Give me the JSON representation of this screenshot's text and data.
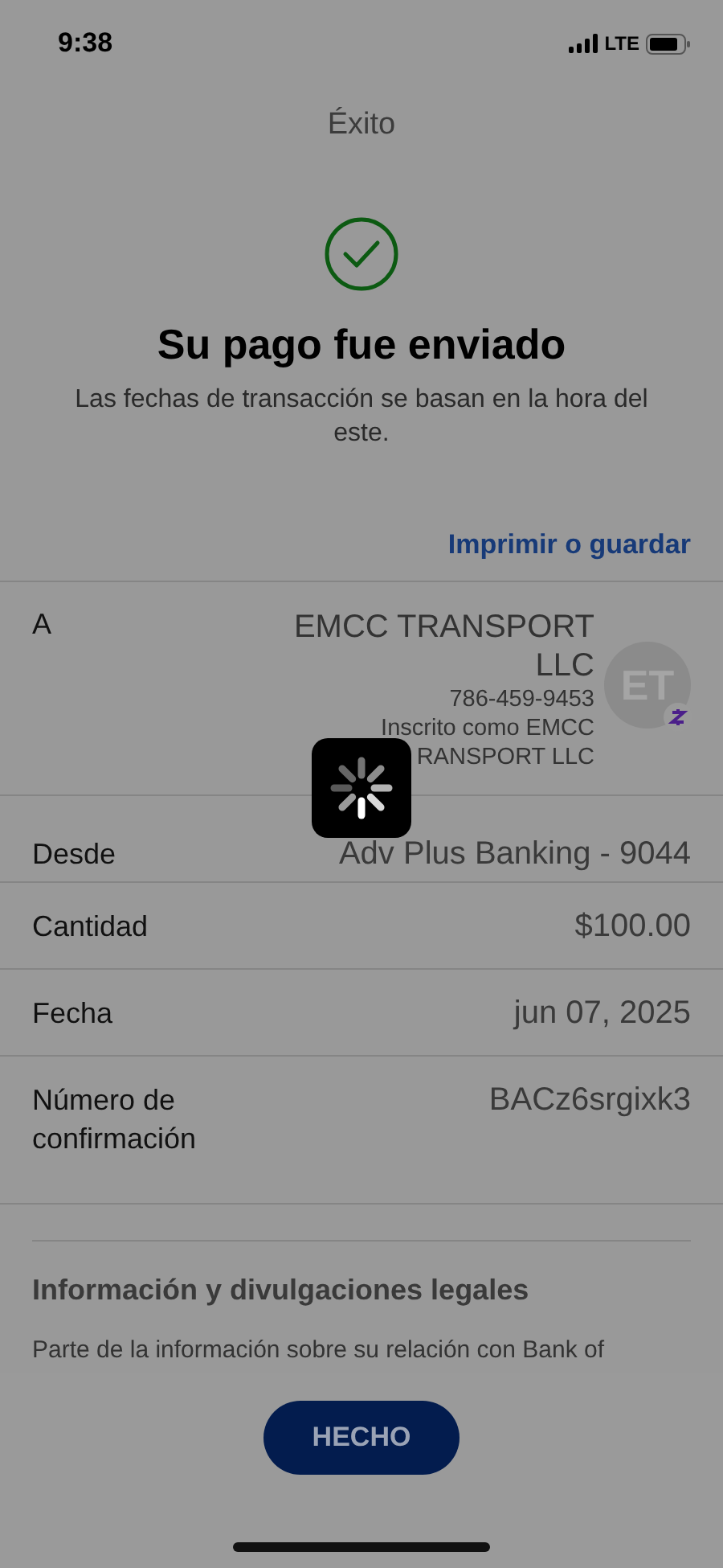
{
  "status_bar": {
    "time": "9:38",
    "network": "LTE"
  },
  "header": {
    "title": "Éxito"
  },
  "confirmation": {
    "heading": "Su pago fue enviado",
    "note": "Las fechas de transacción se basan en la hora del este."
  },
  "print_link": "Imprimir o guardar",
  "recipient": {
    "label": "A",
    "name": "EMCC TRANSPORT LLC",
    "phone": "786-459-9453",
    "enrolled": [
      "Inscrito como EMCC",
      "RANSPORT LLC"
    ],
    "initials": "ET"
  },
  "details": [
    {
      "label": "Desde",
      "value": "Adv Plus Banking - 9044"
    },
    {
      "label": "Cantidad",
      "value": "$100.00"
    },
    {
      "label": "Fecha",
      "value": "jun 07, 2025"
    },
    {
      "label": "Número de confirmación",
      "value": "BACz6srgixk3"
    }
  ],
  "legal": {
    "heading": "Información y divulgaciones legales",
    "text": "Parte de la información sobre su relación con Bank of"
  },
  "done_button": "HECHO",
  "loading": true
}
